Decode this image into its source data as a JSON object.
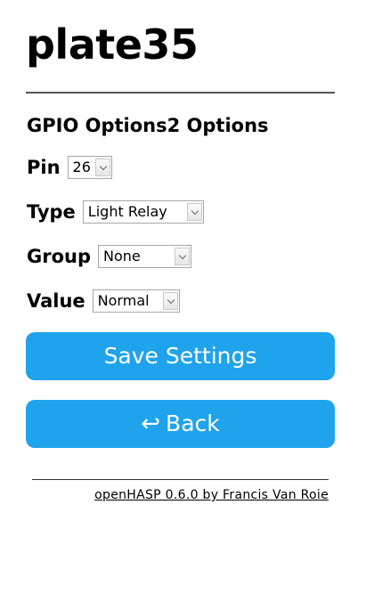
{
  "page": {
    "title": "plate35"
  },
  "section": {
    "heading": "GPIO Options2 Options"
  },
  "fields": {
    "pin": {
      "label": "Pin",
      "value": "26"
    },
    "type": {
      "label": "Type",
      "value": "Light Relay"
    },
    "group": {
      "label": "Group",
      "value": "None"
    },
    "value": {
      "label": "Value",
      "value": "Normal"
    }
  },
  "buttons": {
    "save": {
      "label": "Save Settings"
    },
    "back": {
      "label": "Back",
      "icon": "back-arrow-icon",
      "glyph": "↩"
    }
  },
  "footer": {
    "link_text": "openHASP 0.6.0 by Francis Van Roie"
  },
  "colors": {
    "accent": "#1fa3ec",
    "button_text": "#ffffff"
  }
}
